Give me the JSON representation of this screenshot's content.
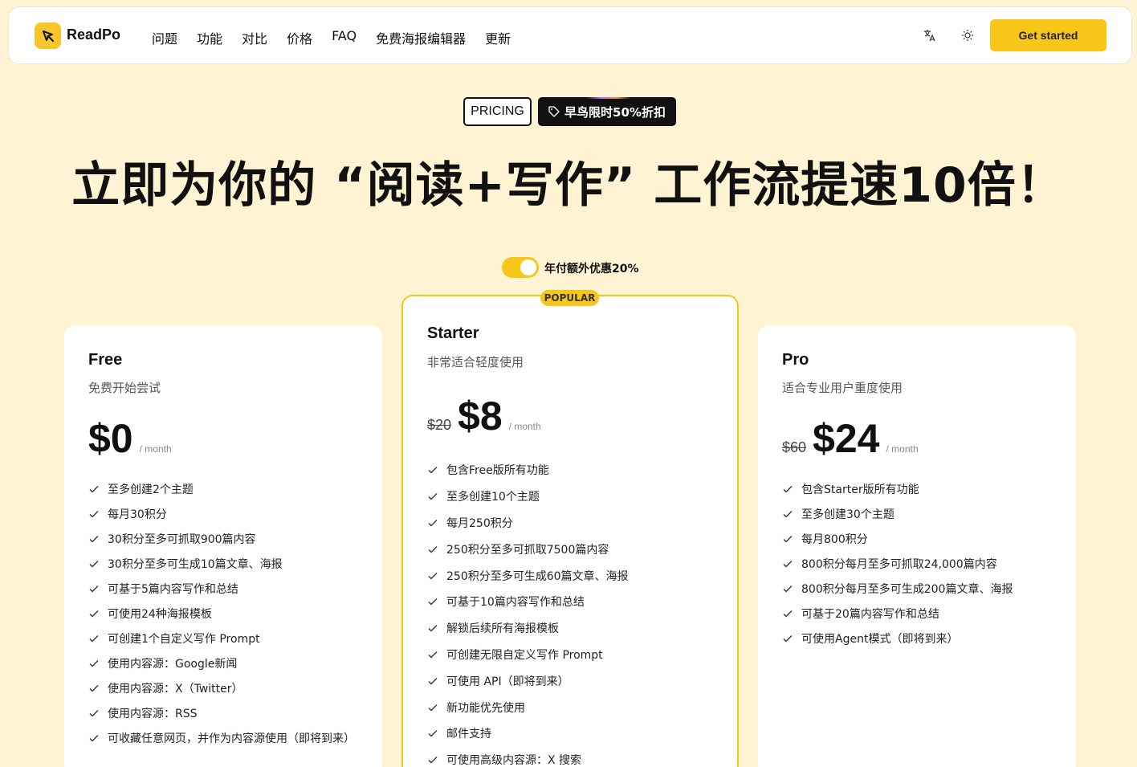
{
  "nav": {
    "brand": "ReadPo",
    "items": [
      "问题",
      "功能",
      "对比",
      "价格",
      "FAQ",
      "免费海报编辑器",
      "更新"
    ],
    "cta_label": "Get started"
  },
  "hero": {
    "badge_pricing": "PRICING",
    "badge_offer": "早鸟限时50%折扣",
    "title": "立即为你的 “阅读+写作” 工作流提速10倍！"
  },
  "billing_toggle": {
    "label": "年付额外优惠20%",
    "on": true
  },
  "plans": [
    {
      "name": "Free",
      "desc": "免费开始尝试",
      "old_price": "",
      "price": "$0",
      "per": "/ month",
      "features": [
        "至多创建2个主题",
        "每月30积分",
        "30积分至多可抓取900篇内容",
        "30积分至多可生成10篇文章、海报",
        "可基于5篇内容写作和总结",
        "可使用24种海报模板",
        "可创建1个自定义写作 Prompt",
        "使用内容源：Google新闻",
        "使用内容源：X（Twitter）",
        "使用内容源：RSS",
        "可收藏任意网页，并作为内容源使用（即将到来）"
      ]
    },
    {
      "name": "Starter",
      "badge": "POPULAR",
      "desc": "非常适合轻度使用",
      "old_price": "$20",
      "price": "$8",
      "per": "/ month",
      "features": [
        "包含Free版所有功能",
        "至多创建10个主题",
        "每月250积分",
        "250积分至多可抓取7500篇内容",
        "250积分至多可生成60篇文章、海报",
        "可基于10篇内容写作和总结",
        "解锁后续所有海报模板",
        "可创建无限自定义写作 Prompt",
        "可使用 API（即将到来）",
        "新功能优先使用",
        "邮件支持",
        "可使用高级内容源：X 搜索"
      ]
    },
    {
      "name": "Pro",
      "desc": "适合专业用户重度使用",
      "old_price": "$60",
      "price": "$24",
      "per": "/ month",
      "features": [
        "包含Starter版所有功能",
        "至多创建30个主题",
        "每月800积分",
        "800积分每月至多可抓取24,000篇内容",
        "800积分每月至多可生成200篇文章、海报",
        "可基于20篇内容写作和总结",
        "可使用Agent模式（即将到来）"
      ]
    }
  ],
  "colors": {
    "accent": "#f8c618",
    "background": "#fef3d2",
    "text": "#111111"
  },
  "icons": [
    "readpo-logo-icon",
    "translate-icon",
    "sun-icon",
    "tag-icon",
    "check-icon"
  ]
}
